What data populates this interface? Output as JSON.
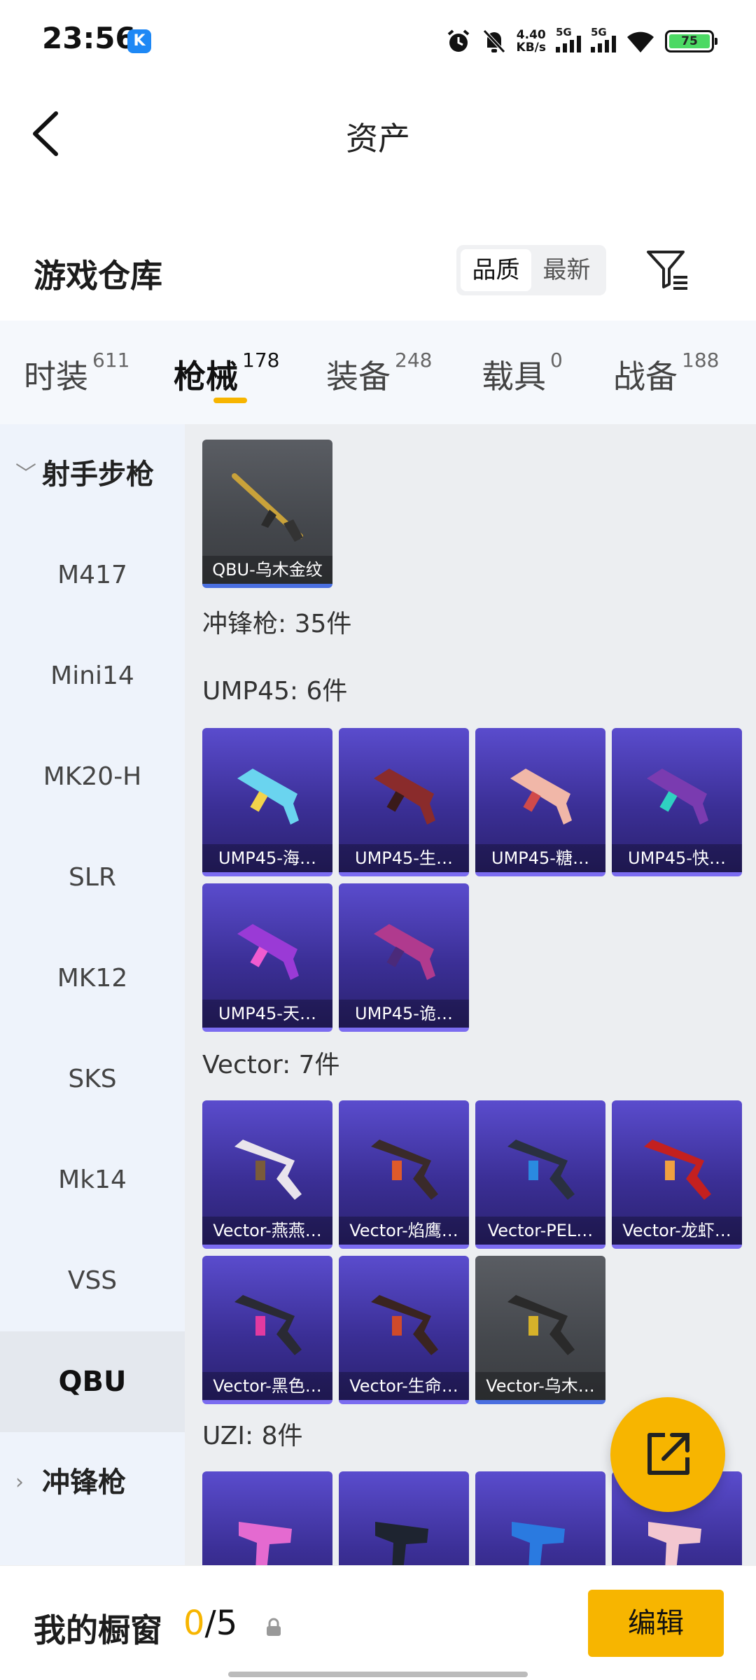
{
  "status_bar": {
    "time": "23:56",
    "k_badge": "K",
    "net_speed": "4.40",
    "net_unit": "KB/s",
    "sim1_label": "5G",
    "sim2_label": "5G",
    "battery": "75",
    "icons": [
      "alarm-icon",
      "mute-icon",
      "wifi-icon"
    ]
  },
  "header": {
    "title": "资产"
  },
  "section": {
    "title": "游戏仓库",
    "sort_options": [
      "品质",
      "最新"
    ],
    "sort_selected": "品质"
  },
  "tabs": [
    {
      "label": "时装",
      "count": "611"
    },
    {
      "label": "枪械",
      "count": "178",
      "active": true
    },
    {
      "label": "装备",
      "count": "248"
    },
    {
      "label": "载具",
      "count": "0"
    },
    {
      "label": "战备",
      "count": "188"
    }
  ],
  "sidebar": {
    "group1": "射手步枪",
    "items": [
      "M417",
      "Mini14",
      "MK20-H",
      "SLR",
      "MK12",
      "SKS",
      "Mk14",
      "VSS",
      "QBU"
    ],
    "active": "QBU",
    "group2": "冲锋枪"
  },
  "content": {
    "top_item": "QBU-乌木金纹",
    "category_header": "冲锋枪: 35件",
    "groups": [
      {
        "title": "UMP45: 6件",
        "items": [
          "UMP45-海…",
          "UMP45-生…",
          "UMP45-糖…",
          "UMP45-快…",
          "UMP45-天…",
          "UMP45-诡…"
        ]
      },
      {
        "title": "Vector: 7件",
        "items": [
          "Vector-燕燕…",
          "Vector-焰鹰…",
          "Vector-PEL…",
          "Vector-龙虾…",
          "Vector-黑色…",
          "Vector-生命…",
          "Vector-乌木…"
        ]
      },
      {
        "title": "UZI: 8件",
        "items": [
          "",
          "",
          "",
          ""
        ]
      }
    ]
  },
  "showcase": {
    "label": "我的橱窗",
    "used": "0",
    "separator": "/",
    "total": "5",
    "edit_label": "编辑"
  },
  "colors": {
    "accent": "#f7b500",
    "card_purple": "#4a3db8",
    "card_gray": "#4a4c51"
  }
}
